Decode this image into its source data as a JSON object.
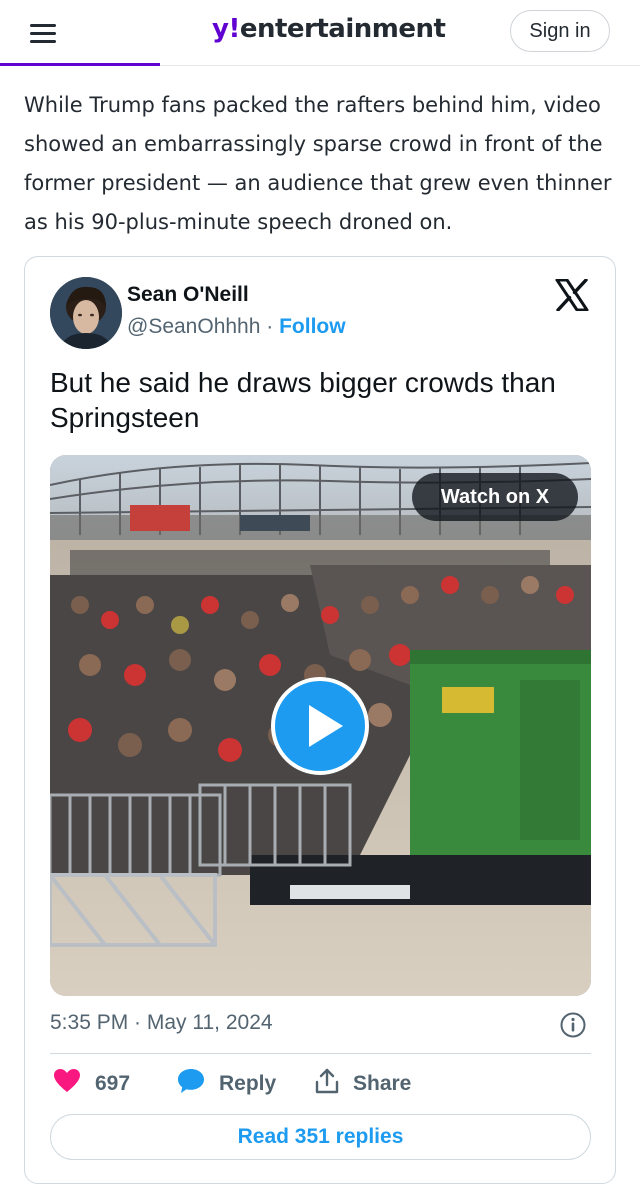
{
  "header": {
    "logo_prefix": "y!",
    "logo_name": "entertainment",
    "signin_label": "Sign in",
    "menu_icon": "hamburger-menu-icon",
    "accent_color": "#6001d2"
  },
  "article": {
    "paragraph": "While Trump fans packed the rafters behind him, video showed an embarrassingly sparse crowd in front of the former president — an audience that grew even thinner as his 90-plus-minute speech droned on."
  },
  "tweet": {
    "author_name": "Sean O'Neill",
    "author_handle": "@SeanOhhhh",
    "separator": " · ",
    "follow_label": "Follow",
    "text": "But he said he draws bigger crowds than Springsteen",
    "watch_label": "Watch on X",
    "timestamp": "5:35 PM · May 11, 2024",
    "likes": "697",
    "reply_label": "Reply",
    "share_label": "Share",
    "read_replies_label": "Read 351 replies",
    "icons": {
      "brand": "x-logo-icon",
      "play": "play-icon",
      "info": "info-icon",
      "like": "heart-icon",
      "reply": "speech-bubble-icon",
      "share": "share-icon"
    },
    "colors": {
      "link": "#1d9bf0",
      "like": "#f91880",
      "secondary_text": "#536471"
    }
  }
}
